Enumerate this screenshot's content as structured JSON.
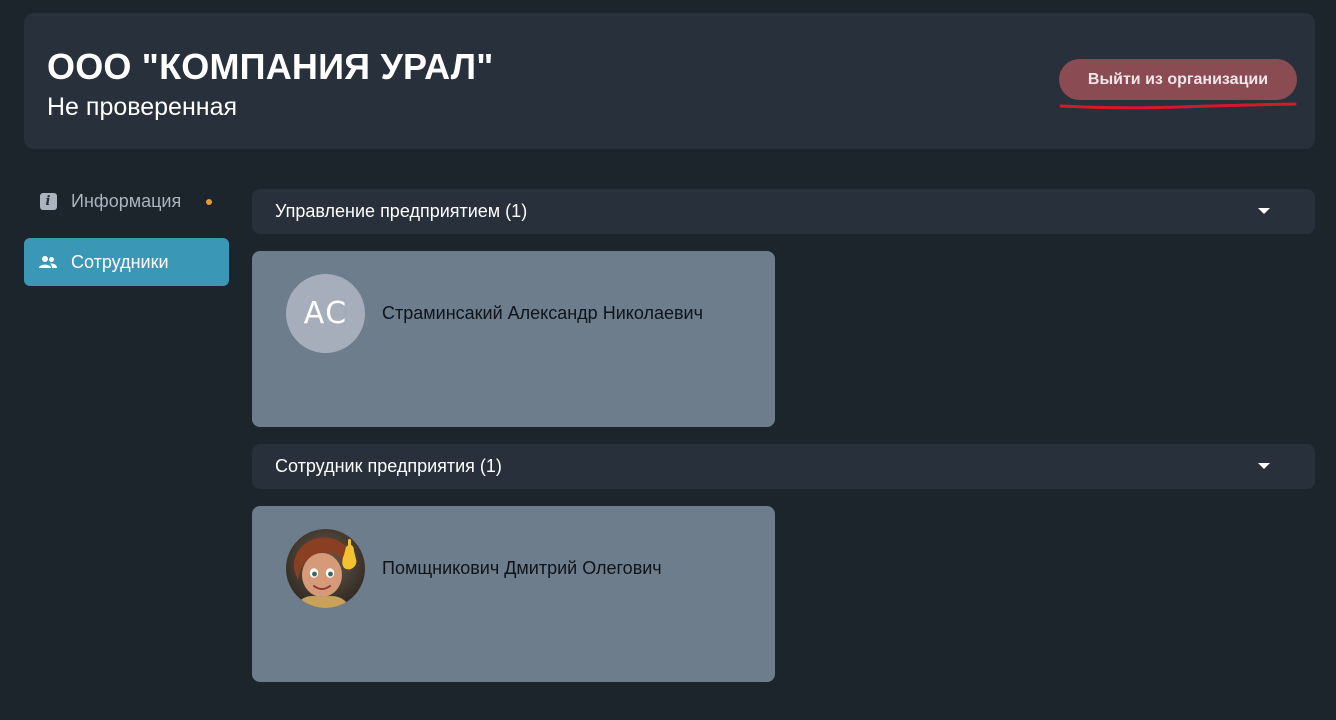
{
  "header": {
    "title": "ООО \"КОМПАНИЯ УРАЛ\"",
    "status": "Не проверенная",
    "leave_button": "Выйти из организации",
    "colors": {
      "leave_button_bg": "#8a4b53",
      "annotation_underline": "#d6192a"
    }
  },
  "sidebar": {
    "items": [
      {
        "label": "Информация",
        "icon": "info-icon",
        "active": false,
        "has_dot": true
      },
      {
        "label": "Сотрудники",
        "icon": "users-icon",
        "active": true
      }
    ],
    "colors": {
      "active_bg": "#3b97b6",
      "dot": "#e89a2c"
    }
  },
  "sections": [
    {
      "title": "Управление предприятием (1)",
      "employees": [
        {
          "name": "Страминсакий Александр Николаевич",
          "avatar_initials": "АС",
          "avatar_type": "initials"
        }
      ]
    },
    {
      "title": "Сотрудник предприятия (1)",
      "employees": [
        {
          "name": "Помщникович Дмитрий Олегович",
          "avatar_type": "photo"
        }
      ]
    }
  ]
}
